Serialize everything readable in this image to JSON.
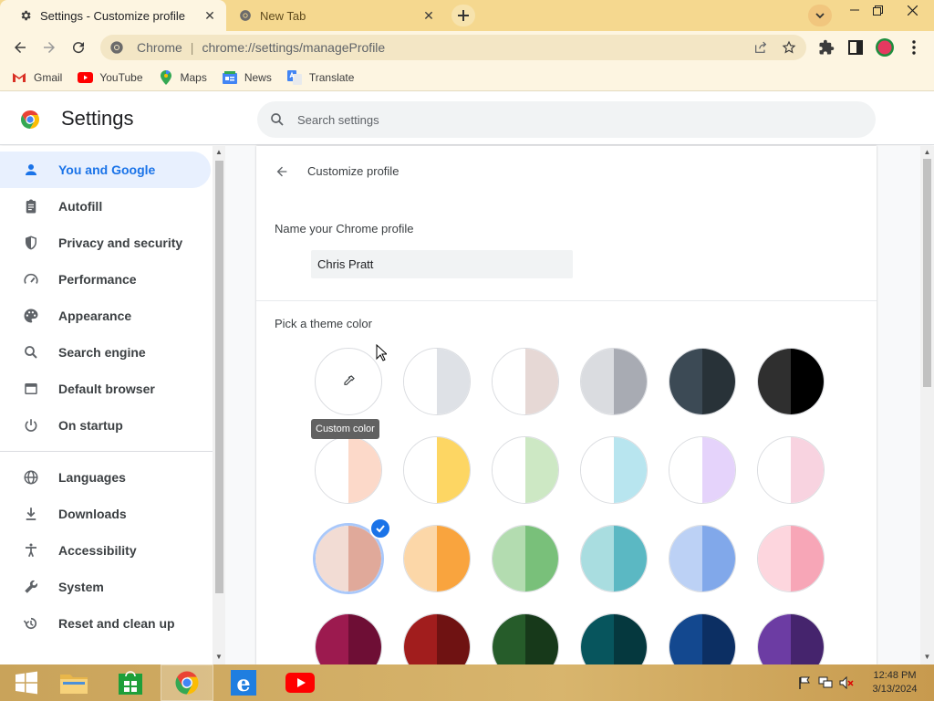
{
  "browser": {
    "tabs": [
      {
        "title": "Settings - Customize profile",
        "active": true
      },
      {
        "title": "New Tab",
        "active": false
      }
    ],
    "omnibox": {
      "site_label": "Chrome",
      "separator": "|",
      "url": "chrome://settings/manageProfile"
    },
    "bookmarks": [
      {
        "label": "Gmail",
        "icon": "gmail-icon"
      },
      {
        "label": "YouTube",
        "icon": "youtube-icon"
      },
      {
        "label": "Maps",
        "icon": "maps-icon"
      },
      {
        "label": "News",
        "icon": "news-icon"
      },
      {
        "label": "Translate",
        "icon": "translate-icon"
      }
    ],
    "colors": {
      "tabstrip": "#f5d88f",
      "toolbar": "#fdf5e1",
      "accent": "#1a73e8"
    }
  },
  "settings": {
    "title": "Settings",
    "search_placeholder": "Search settings",
    "nav": [
      {
        "label": "You and Google",
        "icon": "person-icon",
        "selected": true
      },
      {
        "label": "Autofill",
        "icon": "clipboard-icon"
      },
      {
        "label": "Privacy and security",
        "icon": "shield-icon"
      },
      {
        "label": "Performance",
        "icon": "speedometer-icon"
      },
      {
        "label": "Appearance",
        "icon": "palette-icon"
      },
      {
        "label": "Search engine",
        "icon": "search-icon"
      },
      {
        "label": "Default browser",
        "icon": "browser-window-icon"
      },
      {
        "label": "On startup",
        "icon": "power-icon"
      },
      {
        "label": "Languages",
        "icon": "globe-icon"
      },
      {
        "label": "Downloads",
        "icon": "download-icon"
      },
      {
        "label": "Accessibility",
        "icon": "accessibility-icon"
      },
      {
        "label": "System",
        "icon": "wrench-icon"
      },
      {
        "label": "Reset and clean up",
        "icon": "history-icon"
      }
    ]
  },
  "profile": {
    "page_title": "Customize profile",
    "name_label": "Name your Chrome profile",
    "name_value": "Chris Pratt",
    "theme_label": "Pick a theme color",
    "custom_color_tooltip": "Custom color",
    "swatches": [
      [
        {
          "left": "#ffffff",
          "right": "#ffffff",
          "custom": true
        },
        {
          "left": "#ffffff",
          "right": "#dee1e6"
        },
        {
          "left": "#ffffff",
          "right": "#e6d8d5"
        },
        {
          "left": "#dadce0",
          "right": "#a8abb3"
        },
        {
          "left": "#3c4a55",
          "right": "#283238"
        },
        {
          "left": "#2f2f2f",
          "right": "#000000"
        }
      ],
      [
        {
          "left": "#ffffff",
          "right": "#fcd9c9"
        },
        {
          "left": "#ffffff",
          "right": "#fdd663"
        },
        {
          "left": "#ffffff",
          "right": "#cde8c4"
        },
        {
          "left": "#ffffff",
          "right": "#b8e5ef"
        },
        {
          "left": "#ffffff",
          "right": "#e5d3fb"
        },
        {
          "left": "#ffffff",
          "right": "#f8d3e0"
        }
      ],
      [
        {
          "left": "#f2dcd4",
          "right": "#e0a99a",
          "selected": true
        },
        {
          "left": "#fcd7a8",
          "right": "#f9a43e"
        },
        {
          "left": "#b3dcb0",
          "right": "#79c07a"
        },
        {
          "left": "#a9dde0",
          "right": "#5bb8c3"
        },
        {
          "left": "#bcd1f5",
          "right": "#81a8ea"
        },
        {
          "left": "#fdd6de",
          "right": "#f7a6b7"
        }
      ],
      [
        {
          "left": "#9c1a4f",
          "right": "#6e0e35"
        },
        {
          "left": "#a11d1d",
          "right": "#6f1212"
        },
        {
          "left": "#265c2a",
          "right": "#17391a"
        },
        {
          "left": "#07555d",
          "right": "#05383e"
        },
        {
          "left": "#13488f",
          "right": "#0c2f63"
        },
        {
          "left": "#6c3ca3",
          "right": "#45246d"
        }
      ]
    ]
  },
  "taskbar": {
    "clock_time": "12:48 PM",
    "clock_date": "3/13/2024"
  }
}
